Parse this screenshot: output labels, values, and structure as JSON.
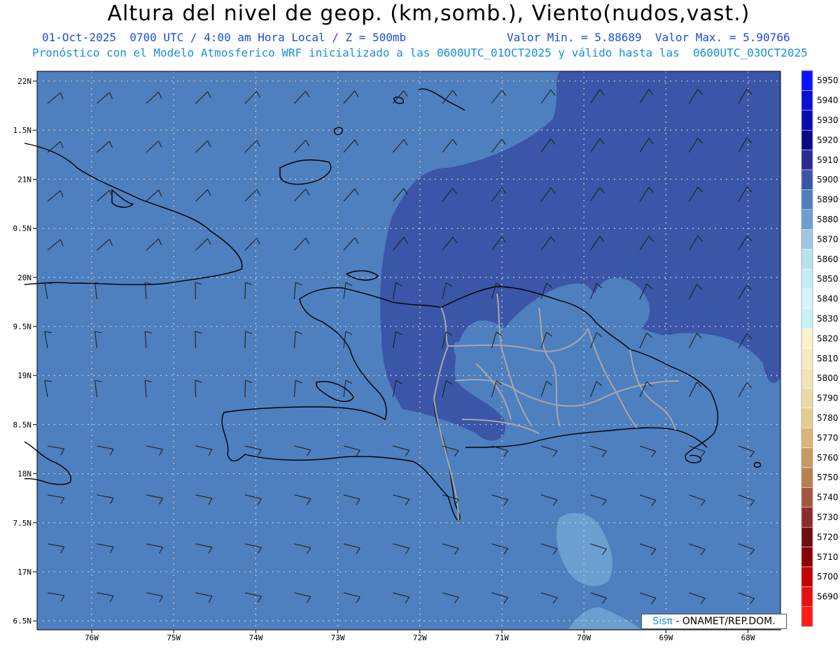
{
  "header": {
    "title": "Altura del nivel de geop. (km,somb.), Viento(nudos,vast.)",
    "date_time": "01-Oct-2025  0700 UTC / 4:00 am Hora Local / Z = 500mb",
    "min_max": "Valor Min. = 5.88689  Valor Max. = 5.90766",
    "model_info": "Pronóstico con el Modelo Atmosferico WRF inicializado a las 0600UTC_01OCT2025 y válido hasta las  0600UTC_03OCT2025"
  },
  "axes": {
    "lat_labels": [
      "22N",
      "1.5N",
      "21N",
      "0.5N",
      "20N",
      "9.5N",
      "19N",
      "8.5N",
      "18N",
      "7.5N",
      "17N",
      "6.5N"
    ],
    "lon_labels": [
      "76W",
      "75W",
      "74W",
      "73W",
      "72W",
      "71W",
      "70W",
      "69W",
      "68W"
    ]
  },
  "colorbar": {
    "levels": [
      {
        "value": "5950",
        "color": "#0a14ff"
      },
      {
        "value": "5940",
        "color": "#0a0fd6"
      },
      {
        "value": "5930",
        "color": "#0a0ab4"
      },
      {
        "value": "5920",
        "color": "#0a0a87"
      },
      {
        "value": "5910",
        "color": "#2a2a8e"
      },
      {
        "value": "5900",
        "color": "#3b55a8"
      },
      {
        "value": "5890",
        "color": "#4e7fbf"
      },
      {
        "value": "5880",
        "color": "#6b9fd0"
      },
      {
        "value": "5870",
        "color": "#9cc6e4"
      },
      {
        "value": "5860",
        "color": "#b5e1ee"
      },
      {
        "value": "5850",
        "color": "#c5ecf5"
      },
      {
        "value": "5840",
        "color": "#d7f2f8"
      },
      {
        "value": "5830",
        "color": "#c8f1f6"
      },
      {
        "value": "5820",
        "color": "#fbf2cd"
      },
      {
        "value": "5810",
        "color": "#f5ebc3"
      },
      {
        "value": "5800",
        "color": "#f1e4b6"
      },
      {
        "value": "5790",
        "color": "#ecd9a6"
      },
      {
        "value": "5780",
        "color": "#e6cb91"
      },
      {
        "value": "5770",
        "color": "#dbb47b"
      },
      {
        "value": "5760",
        "color": "#c99863"
      },
      {
        "value": "5750",
        "color": "#b7804d"
      },
      {
        "value": "5740",
        "color": "#a3573a"
      },
      {
        "value": "5730",
        "color": "#8c2b2c"
      },
      {
        "value": "5720",
        "color": "#6e0d12"
      },
      {
        "value": "5710",
        "color": "#8a0000"
      },
      {
        "value": "5700",
        "color": "#c60000"
      },
      {
        "value": "5690",
        "color": "#e61010"
      },
      {
        "value": "",
        "color": "#ff1a1a"
      }
    ]
  },
  "credit": {
    "sis": "Sisπ",
    "rest": " - ONAMET/REP.DOM."
  }
}
